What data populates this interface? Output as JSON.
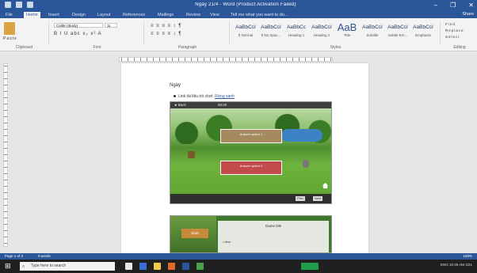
{
  "window": {
    "title": "Ngày 21/4 - Word (Product Activation Failed)",
    "share": "Share",
    "controls": [
      "–",
      "❐",
      "✕"
    ]
  },
  "tabs": [
    {
      "label": "File"
    },
    {
      "label": "Home",
      "active": true
    },
    {
      "label": "Insert"
    },
    {
      "label": "Design"
    },
    {
      "label": "Layout"
    },
    {
      "label": "References"
    },
    {
      "label": "Mailings"
    },
    {
      "label": "Review"
    },
    {
      "label": "View"
    },
    {
      "label": "Tell me what you want to do..."
    }
  ],
  "ribbon": {
    "clipboard_label": "Clipboard",
    "font_label": "Font",
    "paragraph_label": "Paragraph",
    "styles_label": "Styles",
    "editing_label": "Editing",
    "paste_label": "Paste",
    "font_name": "Calibri (Body)",
    "font_size": "11",
    "font_glyphs": "B I U abc x₂ x² A",
    "paragraph_glyphs": "≡ ≡ ≡ ≡ ↕ ¶",
    "styles": [
      {
        "preview": "AaBbCcI",
        "name": "¶ Normal"
      },
      {
        "preview": "AaBbCcI",
        "name": "¶ No Spac..."
      },
      {
        "preview": "AaBbCc",
        "name": "Heading 1"
      },
      {
        "preview": "AaBbCcI",
        "name": "Heading 2"
      },
      {
        "preview": "AaB",
        "name": "Title",
        "big": true
      },
      {
        "preview": "AaBbCcI",
        "name": "Subtitle"
      },
      {
        "preview": "AaBbCcI",
        "name": "Subtle Em..."
      },
      {
        "preview": "AaBbCcI",
        "name": "Emphasis"
      }
    ],
    "editing_items": [
      "Find",
      "Replace",
      "Select"
    ]
  },
  "document": {
    "heading": "Ngày",
    "bullet_text": "Link tài liệu trò chơi:",
    "bullet_link": "Rừng xanh",
    "game1": {
      "top_left": "◄ Back",
      "top_mid": "00:00",
      "answer1": "Answer option 1",
      "answer2": "Answer option 2",
      "btn1": "Prev",
      "btn2": "Next"
    },
    "game2": {
      "side_label": "Start",
      "title": "Game title",
      "item": "• Item"
    }
  },
  "statusbar": {
    "left": "Page 1 of 3",
    "words": "0 words",
    "right": "100%"
  },
  "taskbar": {
    "search_placeholder": "Type here to search",
    "tray_text": "ENG 10:45 AM 4/21"
  }
}
